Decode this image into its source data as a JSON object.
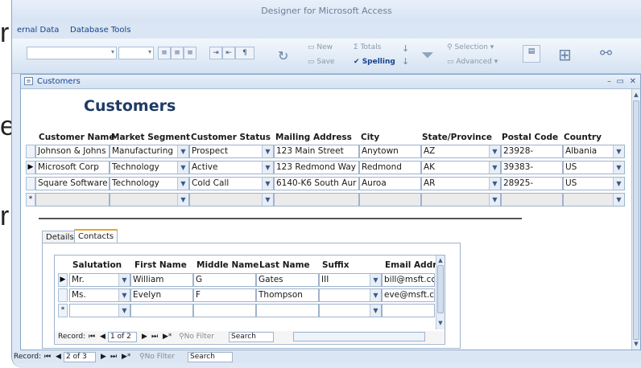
{
  "background_fragments": [
    "r",
    "e",
    "r"
  ],
  "app": {
    "title": "Designer for Microsoft Access",
    "ribbon_tabs": [
      "ernal Data",
      "Database Tools"
    ],
    "ribbon": {
      "new_label": "New",
      "save_label": "Save",
      "totals_label": "Totals",
      "spelling_label": "Spelling",
      "selection_label": "Selection",
      "advanced_label": "Advanced"
    }
  },
  "form": {
    "window_title": "Customers",
    "heading": "Customers",
    "columns": [
      "Customer Name",
      "Market Segment",
      "Customer Status",
      "Mailing Address",
      "City",
      "State/Province",
      "Postal Code",
      "Country"
    ],
    "rows": [
      {
        "selector": "",
        "name": "Johnson & Johns",
        "segment": "Manufacturing",
        "status": "Prospect",
        "address": "123 Main Street",
        "city": "Anytown",
        "state": "AZ",
        "postal": "23928-",
        "country": "Albania"
      },
      {
        "selector": "▶",
        "name": "Microsoft Corp",
        "segment": "Technology",
        "status": "Active",
        "address": "123 Redmond Way",
        "city": "Redmond",
        "state": "AK",
        "postal": "39383-",
        "country": "US"
      },
      {
        "selector": "",
        "name": "Square Software",
        "segment": "Technology",
        "status": "Cold Call",
        "address": "6140-K6 South Aur",
        "city": "Auroa",
        "state": "AR",
        "postal": "28925-",
        "country": "US"
      }
    ],
    "new_row_marker": "*",
    "tabs": [
      "Details",
      "Contacts"
    ],
    "active_tab": "Contacts"
  },
  "contacts": {
    "columns": [
      "Salutation",
      "First Name",
      "Middle Name",
      "Last Name",
      "Suffix",
      "Email Addr"
    ],
    "rows": [
      {
        "selector": "▶",
        "salutation": "Mr.",
        "first": "William",
        "middle": "G",
        "last": "Gates",
        "suffix": "III",
        "email": "bill@msft.cc"
      },
      {
        "selector": "",
        "salutation": "Ms.",
        "first": "Evelyn",
        "middle": "F",
        "last": "Thompson",
        "suffix": "",
        "email": "eve@msft.c"
      }
    ],
    "new_row_marker": "*",
    "nav": {
      "record_label": "Record:",
      "position": "1 of 2",
      "no_filter": "No Filter",
      "search": "Search"
    }
  },
  "main_nav": {
    "record_label": "Record:",
    "position": "2 of 3",
    "no_filter": "No Filter",
    "search": "Search"
  }
}
